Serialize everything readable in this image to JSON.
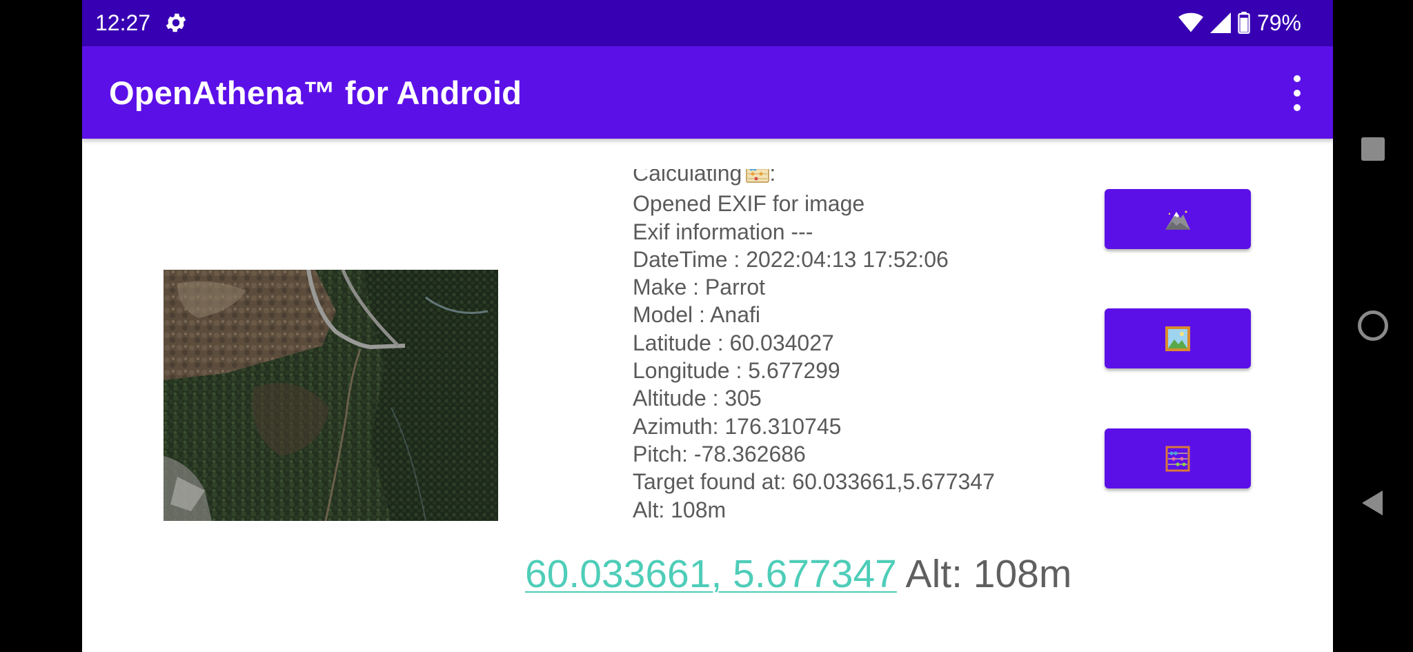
{
  "status_bar": {
    "time": "12:27",
    "battery_percent": "79%",
    "icons": [
      "settings-gear-icon",
      "wifi-icon",
      "cell-signal-icon",
      "battery-icon"
    ]
  },
  "app_bar": {
    "title": "OpenAthena™ for Android",
    "overflow_icon": "more-vert-icon"
  },
  "image": {
    "description_icon": "aerial-drone-photo"
  },
  "log": {
    "calculating": "Calculating",
    "calculating_suffix": ":",
    "lines": [
      "Opened EXIF for image",
      "Exif information ---",
      "DateTime : 2022:04:13 17:52:06",
      "Make : Parrot",
      "Model : Anafi",
      "Latitude : 60.034027",
      "Longitude : 5.677299",
      "Altitude : 305",
      "Azimuth: 176.310745",
      "Pitch: -78.362686",
      "Target found at: 60.033661,5.677347",
      "Alt: 108m"
    ]
  },
  "buttons": {
    "select_dem": {
      "icon": "mountain-icon"
    },
    "select_image": {
      "icon": "framed-picture-icon"
    },
    "calculate": {
      "icon": "abacus-icon"
    }
  },
  "result": {
    "coordinates": "60.033661, 5.677347",
    "altitude": " Alt: 108m"
  },
  "colors": {
    "status_bar": "#3700b3",
    "app_bar": "#5c10e8",
    "button": "#5c10e8",
    "link": "#4ecdb8",
    "text": "#5a5a5a"
  },
  "nav_bar": {
    "icons": [
      "recents-square-icon",
      "home-circle-icon",
      "back-triangle-icon"
    ]
  }
}
